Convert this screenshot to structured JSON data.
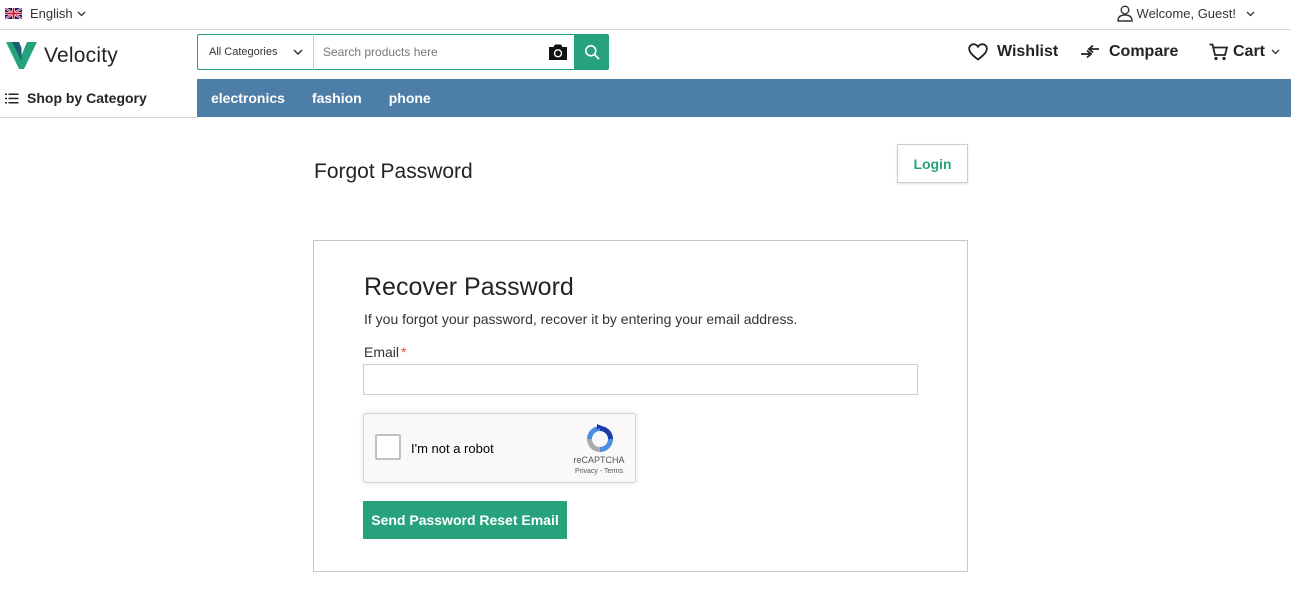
{
  "topbar": {
    "language": "English",
    "welcome": "Welcome, Guest!"
  },
  "header": {
    "brand": "Velocity",
    "search": {
      "category": "All Categories",
      "placeholder": "Search products here"
    },
    "actions": {
      "wishlist": "Wishlist",
      "compare": "Compare",
      "cart": "Cart"
    }
  },
  "nav": {
    "shop_by_category": "Shop by Category",
    "links": [
      "electronics",
      "fashion",
      "phone"
    ]
  },
  "main": {
    "page_title": "Forgot Password",
    "login_label": "Login",
    "card": {
      "title": "Recover Password",
      "description": "If you forgot your password, recover it by entering your email address.",
      "email_label": "Email",
      "required_mark": "*",
      "email_value": "",
      "send_label": "Send Password Reset Email"
    },
    "recaptcha": {
      "label": "I'm not a robot",
      "brand": "reCAPTCHA",
      "privacy": "Privacy",
      "separator": " - ",
      "terms": "Terms"
    }
  },
  "colors": {
    "accent": "#26a37c",
    "nav_bg": "#4d7ea8",
    "required": "#e74c3c"
  }
}
